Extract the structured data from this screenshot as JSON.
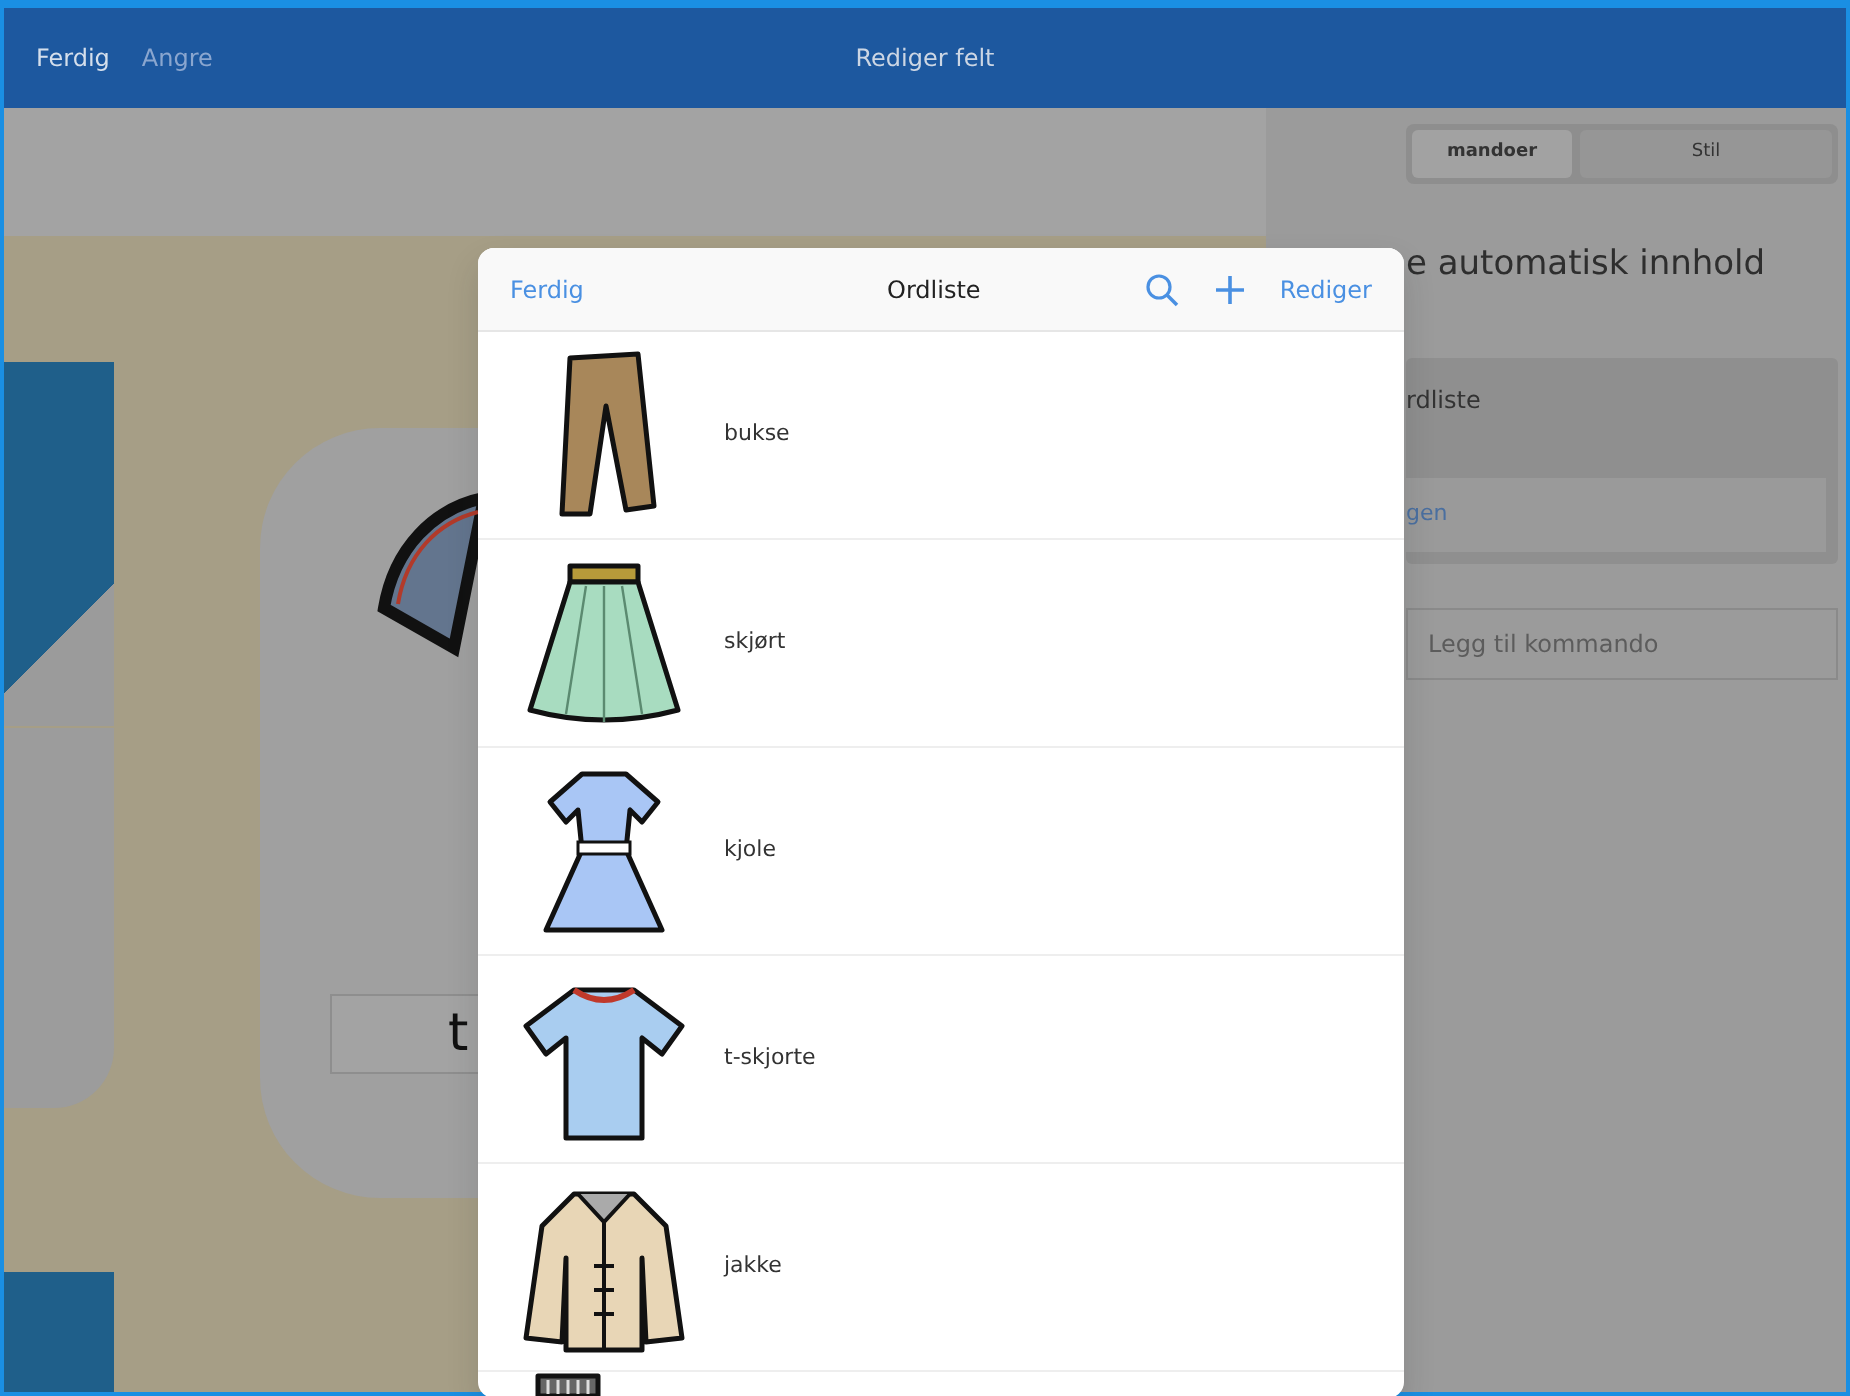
{
  "window": {
    "title": "Rediger felt"
  },
  "toolbar": [
    {
      "label": "Ferdig",
      "disabled": false
    },
    {
      "label": "Angre",
      "disabled": true
    }
  ],
  "canvas": {
    "cell_label": "t"
  },
  "inspector": {
    "tabs": [
      {
        "label": "mandoer",
        "selected": true
      },
      {
        "label": "Stil",
        "selected": false
      }
    ],
    "heading": "e automatisk innhold",
    "card_title": "rdliste",
    "card_button": "gen",
    "add_button": "Legg til kommando"
  },
  "popover": {
    "done": "Ferdig",
    "title": "Ordliste",
    "edit": "Rediger",
    "items": [
      {
        "kind": "trousers",
        "label": "bukse"
      },
      {
        "kind": "skirt",
        "label": "skjørt"
      },
      {
        "kind": "dress",
        "label": "kjole"
      },
      {
        "kind": "tshirt",
        "label": "t-skjorte"
      },
      {
        "kind": "jacket",
        "label": "jakke"
      },
      {
        "kind": "sweater"
      }
    ]
  }
}
